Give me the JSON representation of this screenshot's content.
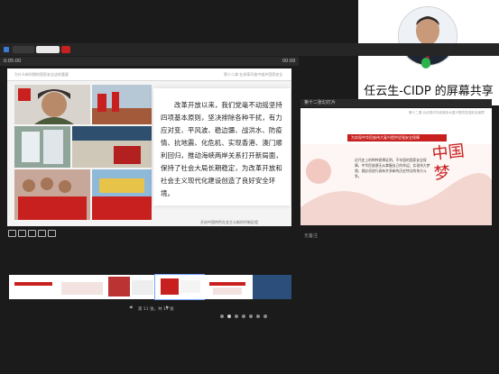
{
  "share": {
    "presenter_label": "任云生-CIDP 的屏幕共享"
  },
  "presenter": {
    "time_left": "0:05:00",
    "time_right": "00:00"
  },
  "main_slide": {
    "header_left": "为什么新时期的国家安全这样重要",
    "header_right": "第十二课 在改革开放中维护国家安全",
    "body": "改革开放以来，我们党毫不动摇坚持四项基本原则，坚决排除各种干扰，有力应对变、平风波、稳边疆、战洪水、防疫情、抗地震、化危机、实现香港、澳门顺利回归，推动海峡两岸关系打开新局面，保持了社会大局长期稳定，为改革开放和社会主义现代化建设创造了良好安全环境。",
    "footer": "开启中国特色社会主义新时代新征程"
  },
  "right_panel": {
    "header": "第十二张幻灯片",
    "slide_header": "第十二课 为实现中华民族伟大复兴提供坚强安全保障",
    "banner": "为实现中华民族伟大复兴提供坚强安全保障",
    "calligraphy": "中国梦",
    "body": "近代史上的种种屈辱证明，不牢固的国家安全保障，中华民族便无从掌握自己的命运；实现伟大梦想，就必须进行具有许多新的历史特点的伟大斗争。",
    "note_label": "无备注"
  },
  "pager": {
    "text": "第 11 张，共 17 张"
  },
  "colors": {
    "accent_red": "#c8201e",
    "mic_green": "#2bb24c"
  }
}
